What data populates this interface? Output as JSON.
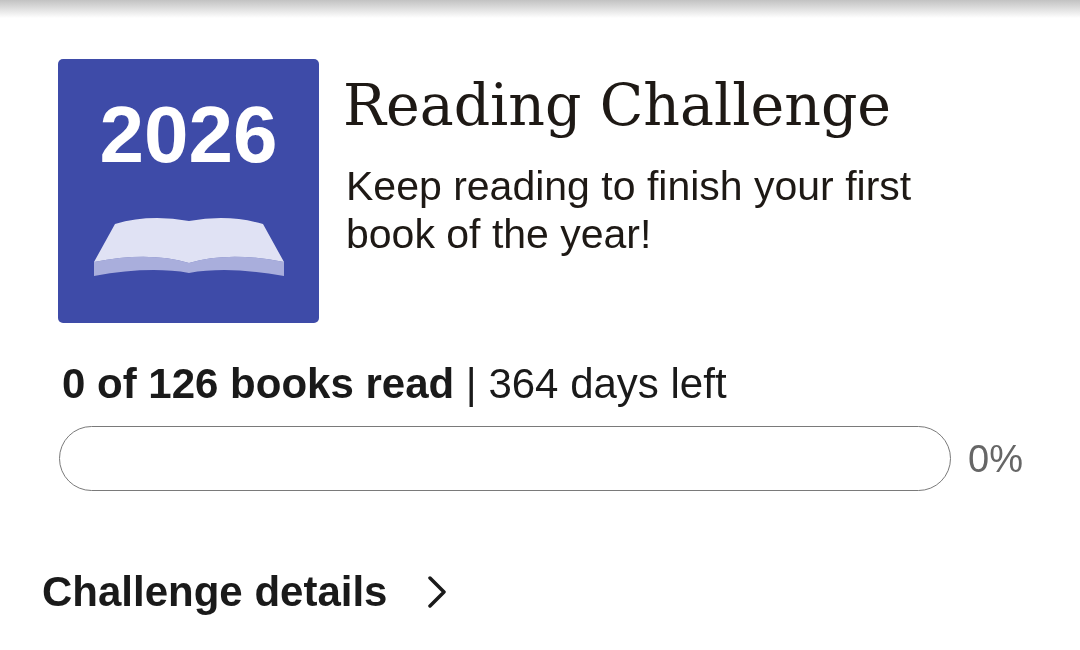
{
  "badge": {
    "year": "2026"
  },
  "title": "Reading Challenge",
  "message": "Keep reading to finish your first book of the year!",
  "progress": {
    "summary": "**0 of 126 books read** | 364 days left",
    "level": 0,
    "percent": "0%"
  },
  "details_link": {
    "label": "Challenge details"
  }
}
